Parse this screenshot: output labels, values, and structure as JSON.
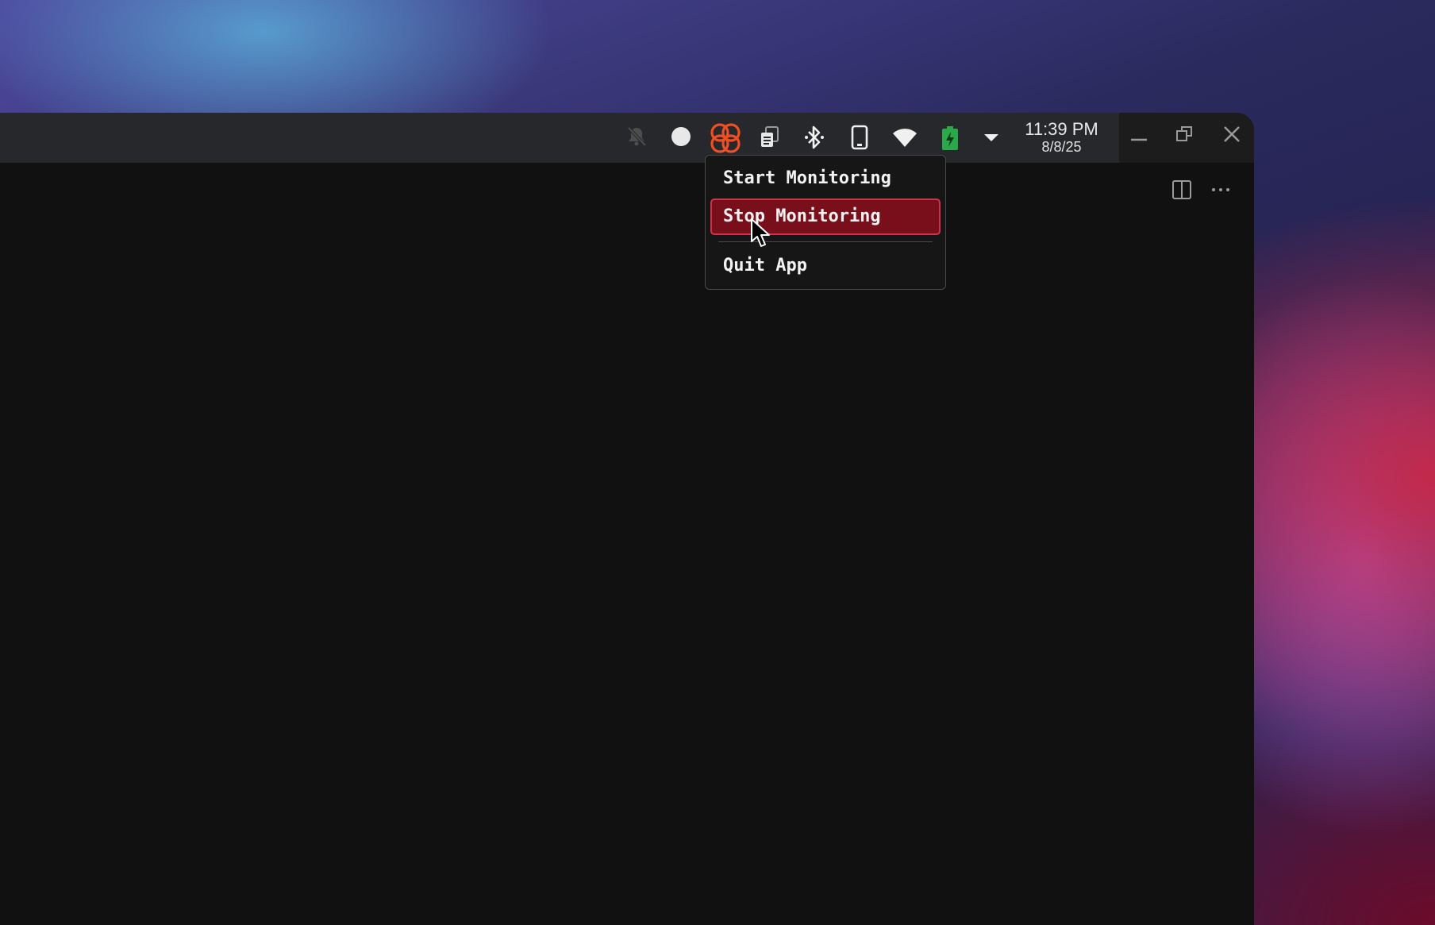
{
  "taskbar": {
    "clock_time": "11:39 PM",
    "clock_date": "8/8/25",
    "tray_icons": [
      "bell-muted-icon",
      "record-dot-icon",
      "app-logo-icon",
      "clipboard-icon",
      "bluetooth-icon",
      "phone-icon",
      "wifi-icon",
      "battery-charging-icon",
      "chevron-down-icon"
    ],
    "accent_color": "#f04e23"
  },
  "window_controls": [
    "minimize-icon",
    "restore-icon",
    "close-icon"
  ],
  "toolbar_icons": [
    "split-view-icon",
    "more-options-icon"
  ],
  "context_menu": {
    "items": [
      {
        "label": "Start Monitoring",
        "state": "normal"
      },
      {
        "label": "Stop Monitoring",
        "state": "highlighted"
      },
      {
        "label": "Quit App",
        "state": "normal"
      }
    ],
    "highlight_color": "#7a0f1c",
    "highlight_border": "#d23248"
  }
}
